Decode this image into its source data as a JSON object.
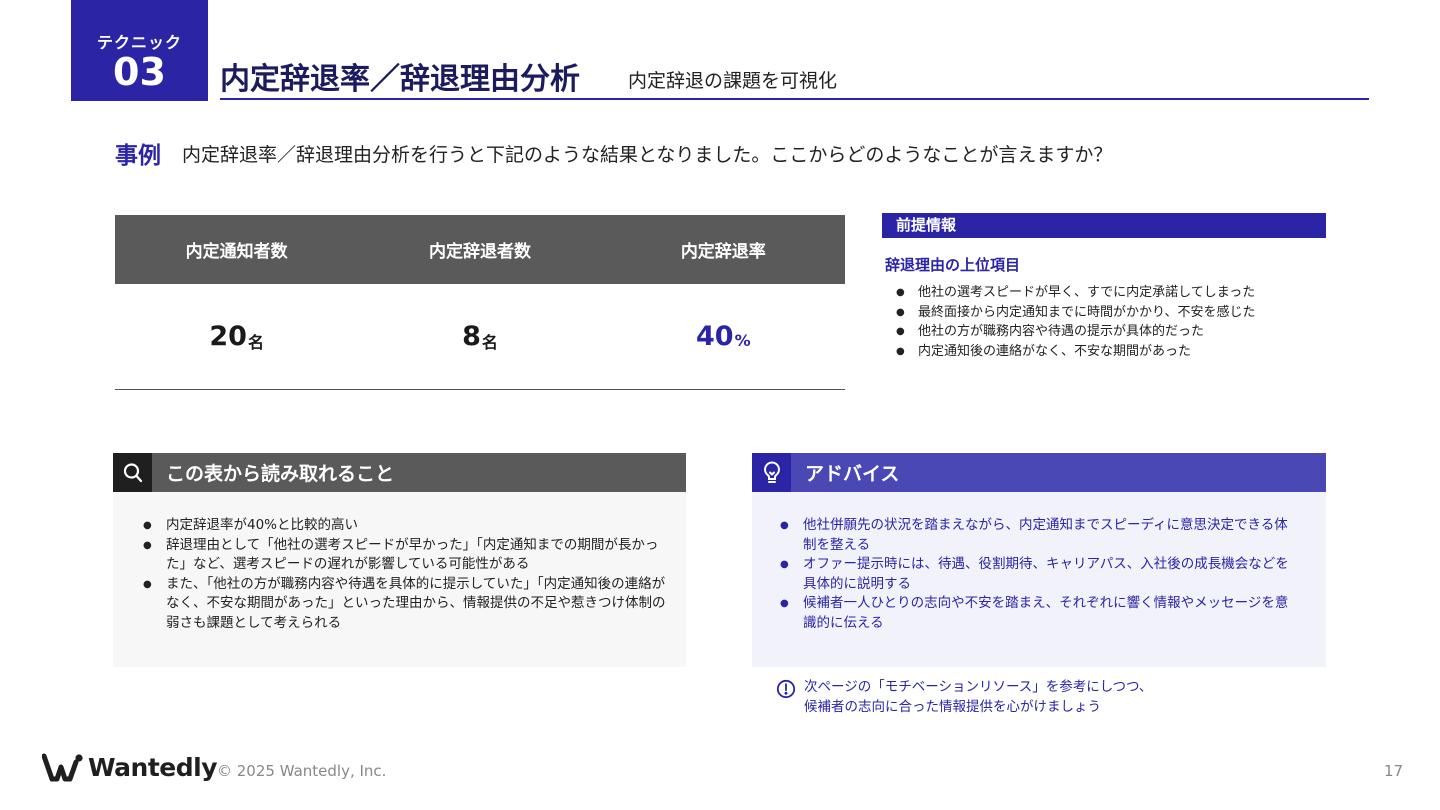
{
  "header": {
    "technique_label": "テクニック",
    "technique_number": "03",
    "title": "内定辞退率／辞退理由分析",
    "subtitle": "内定辞退の課題を可視化"
  },
  "case": {
    "label": "事例",
    "text": "内定辞退率／辞退理由分析を行うと下記のような結果となりました。ここからどのようなことが言えますか？"
  },
  "table": {
    "headers": [
      "内定通知者数",
      "内定辞退者数",
      "内定辞退率"
    ],
    "values": [
      {
        "number": "20",
        "unit": "名"
      },
      {
        "number": "8",
        "unit": "名"
      },
      {
        "number": "40",
        "unit": "%"
      }
    ]
  },
  "premise": {
    "bar_label": "前提情報",
    "heading": "辞退理由の上位項目",
    "items": [
      "他社の選考スピードが早く、すでに内定承諾してしまった",
      "最終面接から内定通知までに時間がかかり、不安を感じた",
      "他社の方が職務内容や待遇の提示が具体的だった",
      "内定通知後の連絡がなく、不安な期間があった"
    ]
  },
  "insights": {
    "title": "この表から読み取れること",
    "items": [
      "内定辞退率が40%と比較的高い",
      "辞退理由として「他社の選考スピードが早かった」「内定通知までの期間が長かった」など、選考スピードの遅れが影響している可能性がある",
      "また、「他社の方が職務内容や待遇を具体的に提示していた」「内定通知後の連絡がなく、不安な期間があった」といった理由から、情報提供の不足や惹きつけ体制の弱さも課題として考えられる"
    ]
  },
  "advice": {
    "title": "アドバイス",
    "items": [
      "他社併願先の状況を踏まえながら、内定通知までスピーディに意思決定できる体制を整える",
      "オファー提示時には、待遇、役割期待、キャリアパス、入社後の成長機会などを具体的に説明する",
      "候補者一人ひとりの志向や不安を踏まえ、それぞれに響く情報やメッセージを意識的に伝える"
    ],
    "note_line1": "次ページの「モチベーションリソース」を参考にしつつ、",
    "note_line2": "候補者の志向に合った情報提供を心がけましょう"
  },
  "footer": {
    "logo_text": "Wantedly",
    "copyright": "© 2025 Wantedly, Inc.",
    "page_number": "17"
  },
  "colors": {
    "brand": "#2b25a6",
    "advice_header": "#4a48b5",
    "table_header": "#5a5a5a"
  },
  "icons": {
    "insights": "search-icon",
    "advice": "lightbulb-icon",
    "note": "exclamation-circle-icon"
  }
}
